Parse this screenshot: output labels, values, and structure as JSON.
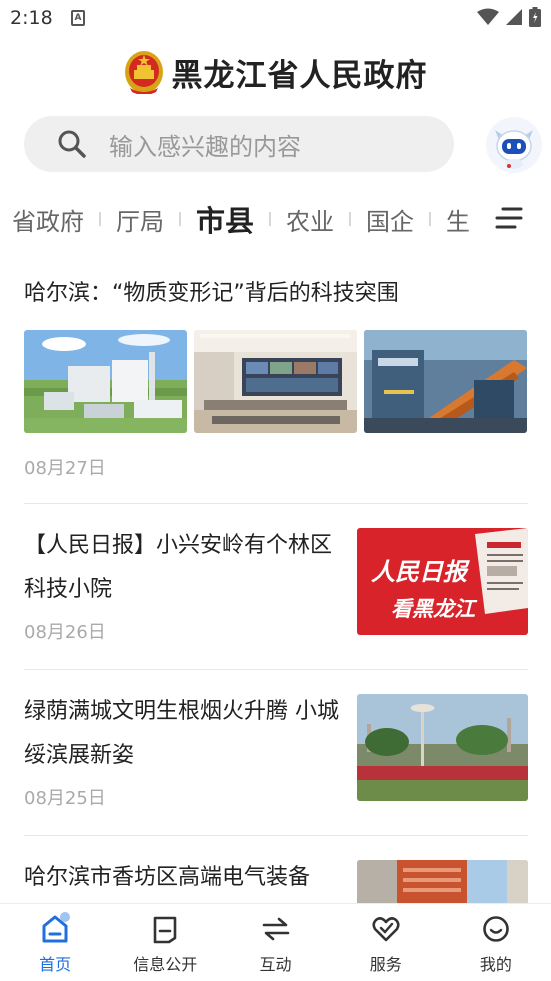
{
  "status_bar": {
    "time": "2:18",
    "notification_glyph": "A",
    "icons": [
      "wifi-icon",
      "signal-icon",
      "battery-icon"
    ]
  },
  "header": {
    "title": "黑龙江省人民政府",
    "emblem_icon": "national-emblem-icon"
  },
  "search": {
    "placeholder": "输入感兴趣的内容"
  },
  "channels": {
    "tabs": [
      {
        "label": "省政府",
        "active": false
      },
      {
        "label": "厅局",
        "active": false
      },
      {
        "label": "市县",
        "active": true
      },
      {
        "label": "农业",
        "active": false
      },
      {
        "label": "国企",
        "active": false
      },
      {
        "label": "生",
        "active": false
      }
    ]
  },
  "news": [
    {
      "title": "哈尔滨：“物质变形记”背后的科技突围",
      "date": "08月27日",
      "layout": "multi"
    },
    {
      "title": "【人民日报】小兴安岭有个林区科技小院",
      "date": "08月26日",
      "layout": "single",
      "image_text_1": "人民日报",
      "image_text_2": "看黑龙江"
    },
    {
      "title": "绿荫满城文明生根烟火升腾 小城绥滨展新姿",
      "date": "08月25日",
      "layout": "single"
    },
    {
      "title": "哈尔滨市香坊区高端电气装备",
      "date": "",
      "layout": "single"
    }
  ],
  "bottom_nav": [
    {
      "label": "首页",
      "icon": "home-icon",
      "active": true
    },
    {
      "label": "信息公开",
      "icon": "info-disclosure-icon",
      "active": false
    },
    {
      "label": "互动",
      "icon": "interaction-icon",
      "active": false
    },
    {
      "label": "服务",
      "icon": "service-heart-icon",
      "active": false
    },
    {
      "label": "我的",
      "icon": "profile-smile-icon",
      "active": false
    }
  ],
  "colors": {
    "accent": "#1f6fe0",
    "search_bg": "#efefef",
    "date_text": "#aaaaaa",
    "paper_red": "#d8232a"
  }
}
